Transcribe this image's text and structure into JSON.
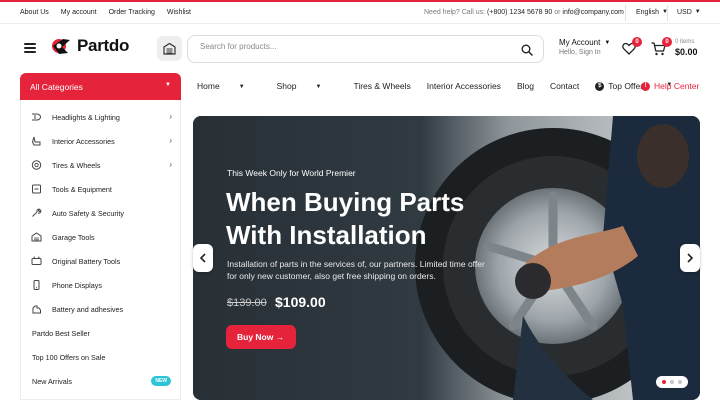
{
  "colors": {
    "accent": "#e5243b",
    "badge_new": "#2ec4d6"
  },
  "utility_bar": {
    "links": [
      "About Us",
      "My account",
      "Order Tracking",
      "Wishlist"
    ],
    "help_prefix": "Need help? Call us:",
    "phone": "(+800) 1234 5678 90",
    "or": "or",
    "email": "info@company.com",
    "language": "English",
    "currency": "USD"
  },
  "header": {
    "brand": "Partdo",
    "search_placeholder": "Search for products...",
    "account_title": "My Account",
    "account_subtitle": "Hello, Sign In",
    "wishlist_count": "0",
    "cart_count": "0",
    "cart_items": "0 items",
    "cart_total": "$0.00"
  },
  "nav": {
    "all_categories": "All Categories",
    "links": [
      "Home",
      "Shop",
      "Tires & Wheels",
      "Interior Accessories",
      "Blog",
      "Contact",
      "Top Offers"
    ],
    "help_center": "Help Center"
  },
  "sidebar": {
    "items": [
      {
        "label": "Headlights & Lighting",
        "icon": "headlight-icon",
        "has_sub": true
      },
      {
        "label": "Interior Accessories",
        "icon": "car-seat-icon",
        "has_sub": true
      },
      {
        "label": "Tires & Wheels",
        "icon": "tire-icon",
        "has_sub": true
      },
      {
        "label": "Tools & Equipment",
        "icon": "tools-icon",
        "has_sub": false
      },
      {
        "label": "Auto Safety & Security",
        "icon": "wrench-icon",
        "has_sub": false
      },
      {
        "label": "Garage Tools",
        "icon": "garage-icon",
        "has_sub": false
      },
      {
        "label": "Original Battery Tools",
        "icon": "battery-icon",
        "has_sub": false
      },
      {
        "label": "Phone Displays",
        "icon": "phone-icon",
        "has_sub": false
      },
      {
        "label": "Battery and adhesives",
        "icon": "adhesive-icon",
        "has_sub": false
      }
    ],
    "extra": [
      "Partdo Best Seller",
      "Top 100 Offers on Sale",
      "New Arrivals"
    ],
    "new_badge": "NEW"
  },
  "hero": {
    "pre_title": "This Week Only for World Premier",
    "title": "When Buying Parts With Installation",
    "description": "Installation of parts in the services of, our partners. Limited time offer for only new customer, also get free shipping on orders.",
    "old_price": "$139.00",
    "new_price": "$109.00",
    "button": "Buy Now",
    "slides": 3,
    "active_slide": 1
  }
}
